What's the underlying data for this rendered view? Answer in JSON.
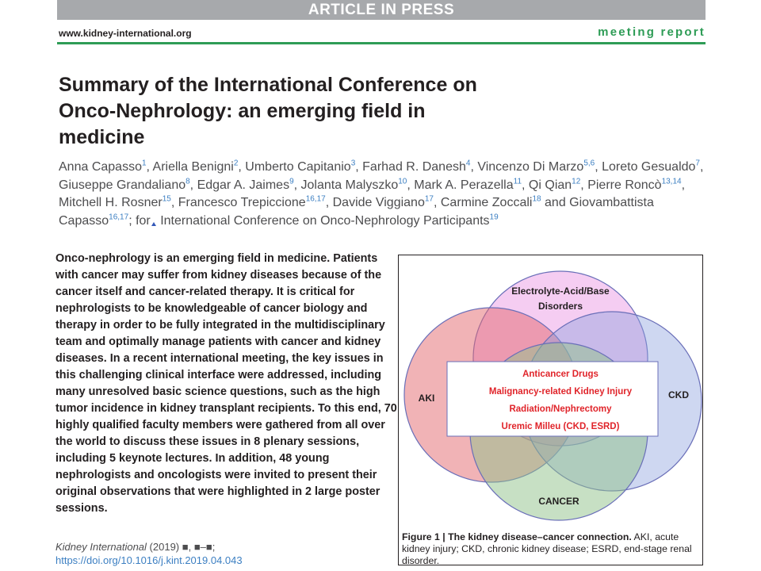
{
  "header": {
    "banner": "ARTICLE IN PRESS",
    "site": "www.kidney-international.org",
    "section": "meeting report"
  },
  "article": {
    "title": "Summary of the International Conference on Onco-Nephrology: an emerging field in medicine",
    "authors": [
      {
        "name": "Anna Capasso",
        "aff": "1"
      },
      {
        "name": "Ariella Benigni",
        "aff": "2"
      },
      {
        "name": "Umberto Capitanio",
        "aff": "3"
      },
      {
        "name": "Farhad R. Danesh",
        "aff": "4"
      },
      {
        "name": "Vincenzo Di Marzo",
        "aff": "5,6"
      },
      {
        "name": "Loreto Gesualdo",
        "aff": "7"
      },
      {
        "name": "Giuseppe Grandaliano",
        "aff": "8"
      },
      {
        "name": "Edgar A. Jaimes",
        "aff": "9"
      },
      {
        "name": "Jolanta Malyszko",
        "aff": "10"
      },
      {
        "name": "Mark A. Perazella",
        "aff": "11"
      },
      {
        "name": "Qi Qian",
        "aff": "12"
      },
      {
        "name": "Pierre Roncò",
        "aff": "13,14"
      },
      {
        "name": "Mitchell H. Rosner",
        "aff": "15"
      },
      {
        "name": "Francesco Trepiccione",
        "aff": "16,17"
      },
      {
        "name": "Davide Viggiano",
        "aff": "17"
      },
      {
        "name": "Carmine Zoccali",
        "aff": "18"
      },
      {
        "name": "Giovambattista Capasso",
        "aff": "16,17"
      }
    ],
    "and_word": "and",
    "group_prefix": "for",
    "group_name": "International Conference on Onco-Nephrology Participants",
    "group_aff": "19",
    "abstract": "Onco-nephrology is an emerging field in medicine. Patients with cancer may suffer from kidney diseases because of the cancer itself and cancer-related therapy. It is critical for nephrologists to be knowledgeable of cancer biology and therapy in order to be fully integrated in the multidisciplinary team and optimally manage patients with cancer and kidney diseases. In a recent international meeting, the key issues in this challenging clinical interface were addressed, including many unresolved basic science questions, such as the high tumor incidence in kidney transplant recipients. To this end, 70 highly qualified faculty members were gathered from all over the world to discuss these issues in 8 plenary sessions, including 5 keynote lectures. In addition, 48 young nephrologists and oncologists were invited to present their original observations that were highlighted in 2 large poster sessions.",
    "citation": {
      "journal": "Kidney International",
      "year": "(2019)",
      "volume": "■, ■–■;",
      "doi": "https://doi.org/10.1016/j.kint.2019.04.043"
    }
  },
  "figure": {
    "circles": [
      {
        "id": "electrolyte",
        "label_line1": "Electrolyte-Acid/Base",
        "label_line2": "Disorders",
        "color": "#e889e0"
      },
      {
        "id": "aki",
        "label": "AKI",
        "color": "#e3676e"
      },
      {
        "id": "ckd",
        "label": "CKD",
        "color": "#8a9fdd"
      },
      {
        "id": "cancer",
        "label": "CANCER",
        "color": "#8fc28a"
      }
    ],
    "center_box_items": [
      "Anticancer Drugs",
      "Malignancy-related Kidney Injury",
      "Radiation/Nephrectomy",
      "Uremic Milleu (CKD, ESRD)"
    ],
    "center_text_color": "#e0242a",
    "caption_label": "Figure 1 | The kidney disease–cancer connection.",
    "caption_text": " AKI, acute kidney injury; CKD, chronic kidney disease; ESRD, end-stage renal disorder."
  },
  "colors": {
    "accent_green": "#2e9c56",
    "link_blue": "#3c7fc2",
    "banner_gray": "#a7a9ac"
  }
}
